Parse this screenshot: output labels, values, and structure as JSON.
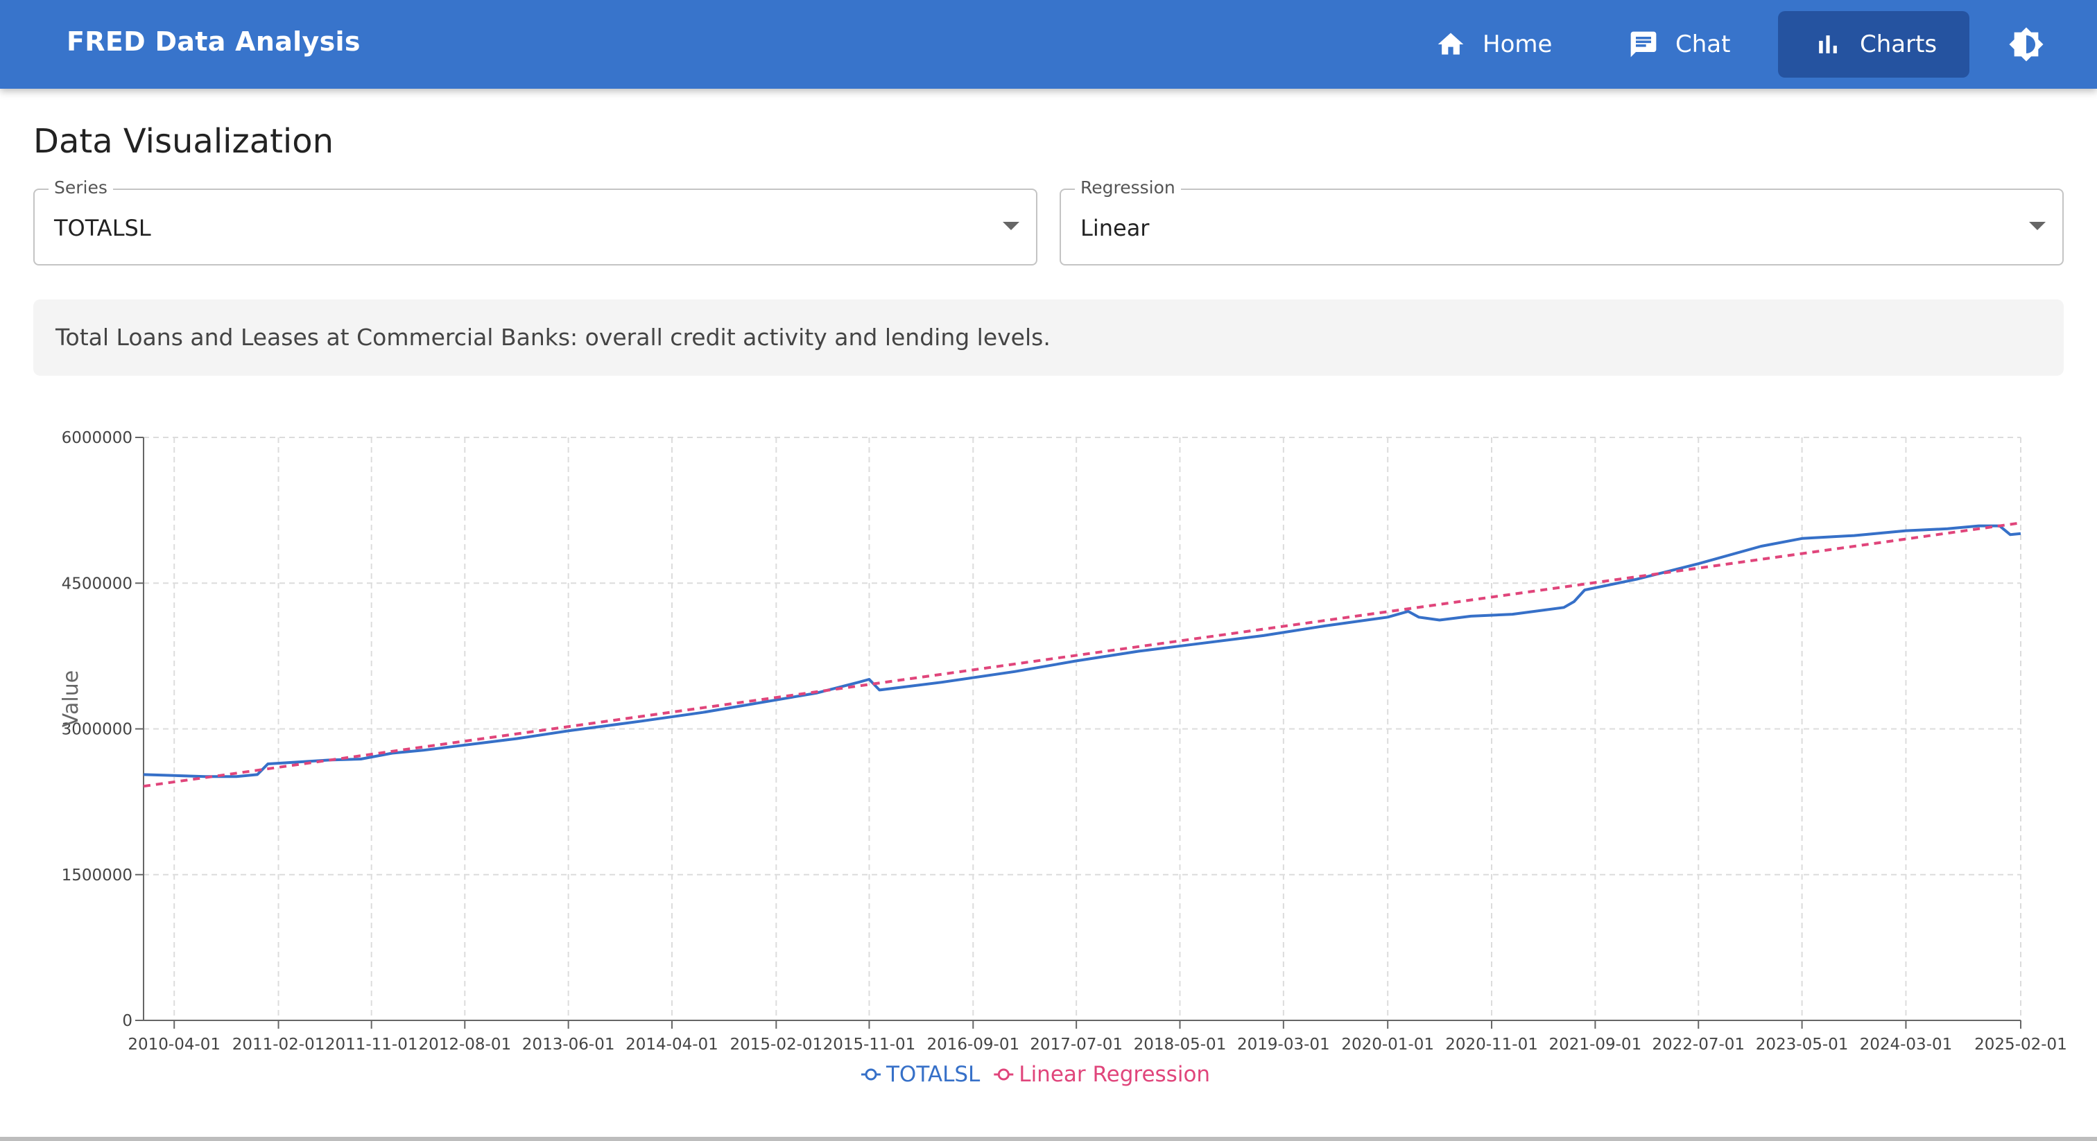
{
  "app": {
    "title": "FRED Data Analysis"
  },
  "nav": {
    "home_label": "Home",
    "chat_label": "Chat",
    "charts_label": "Charts",
    "active": "Charts"
  },
  "page": {
    "title": "Data Visualization"
  },
  "controls": {
    "series": {
      "label": "Series",
      "value": "TOTALSL"
    },
    "regression": {
      "label": "Regression",
      "value": "Linear"
    }
  },
  "description": "Total Loans and Leases at Commercial Banks: overall credit activity and lending levels.",
  "colors": {
    "appbar": "#3874cb",
    "active_nav": "#2553a0",
    "series": "#3670c8",
    "regression": "#e0457b"
  },
  "icons": {
    "home": "home-icon",
    "chat": "chat-icon",
    "charts": "bar-chart-icon",
    "theme": "brightness-icon"
  },
  "chart_data": {
    "type": "line",
    "ylabel": "Value",
    "xlabel": "",
    "ylim": [
      0,
      6000000
    ],
    "yticks": [
      0,
      1500000,
      3000000,
      4500000,
      6000000
    ],
    "ytick_labels": [
      "0",
      "1500000",
      "3000000",
      "4500000",
      "6000000"
    ],
    "xtick_labels": [
      "2010-04-01",
      "2011-02-01",
      "2011-11-01",
      "2012-08-01",
      "2013-06-01",
      "2014-04-01",
      "2015-02-01",
      "2015-11-01",
      "2016-09-01",
      "2017-07-01",
      "2018-05-01",
      "2019-03-01",
      "2020-01-01",
      "2020-11-01",
      "2021-09-01",
      "2022-07-01",
      "2023-05-01",
      "2024-03-01",
      "2025-02-01"
    ],
    "x_range": [
      "2010-01-01",
      "2025-02-01"
    ],
    "grid": true,
    "legend_position": "bottom",
    "series": [
      {
        "name": "TOTALSL",
        "style": "solid",
        "x": [
          "2010-01-01",
          "2010-04-01",
          "2010-07-01",
          "2010-10-01",
          "2010-11-01",
          "2010-12-01",
          "2011-01-01",
          "2011-04-01",
          "2011-07-01",
          "2011-10-01",
          "2012-01-01",
          "2012-04-01",
          "2012-07-01",
          "2012-10-01",
          "2013-01-01",
          "2013-06-01",
          "2014-01-01",
          "2014-07-01",
          "2015-01-01",
          "2015-06-01",
          "2015-10-01",
          "2015-11-01",
          "2015-12-01",
          "2016-06-01",
          "2017-01-01",
          "2017-07-01",
          "2018-01-01",
          "2018-07-01",
          "2019-01-01",
          "2019-07-01",
          "2020-01-01",
          "2020-03-01",
          "2020-04-01",
          "2020-06-01",
          "2020-09-01",
          "2021-01-01",
          "2021-06-01",
          "2021-07-01",
          "2021-08-01",
          "2022-01-01",
          "2022-07-01",
          "2023-01-01",
          "2023-05-01",
          "2023-10-01",
          "2024-03-01",
          "2024-07-01",
          "2024-10-01",
          "2024-12-01",
          "2025-01-01",
          "2025-02-01"
        ],
        "y": [
          2530000,
          2520000,
          2510000,
          2510000,
          2520000,
          2530000,
          2640000,
          2660000,
          2680000,
          2690000,
          2750000,
          2780000,
          2820000,
          2860000,
          2900000,
          2980000,
          3080000,
          3170000,
          3280000,
          3370000,
          3480000,
          3510000,
          3400000,
          3480000,
          3590000,
          3700000,
          3800000,
          3880000,
          3960000,
          4060000,
          4150000,
          4210000,
          4150000,
          4120000,
          4160000,
          4180000,
          4250000,
          4310000,
          4430000,
          4540000,
          4700000,
          4880000,
          4960000,
          4990000,
          5040000,
          5060000,
          5090000,
          5090000,
          5000000,
          5010000
        ]
      },
      {
        "name": "Linear Regression",
        "style": "dashed",
        "x": [
          "2010-01-01",
          "2025-02-01"
        ],
        "y": [
          2410000,
          5120000
        ]
      }
    ]
  }
}
